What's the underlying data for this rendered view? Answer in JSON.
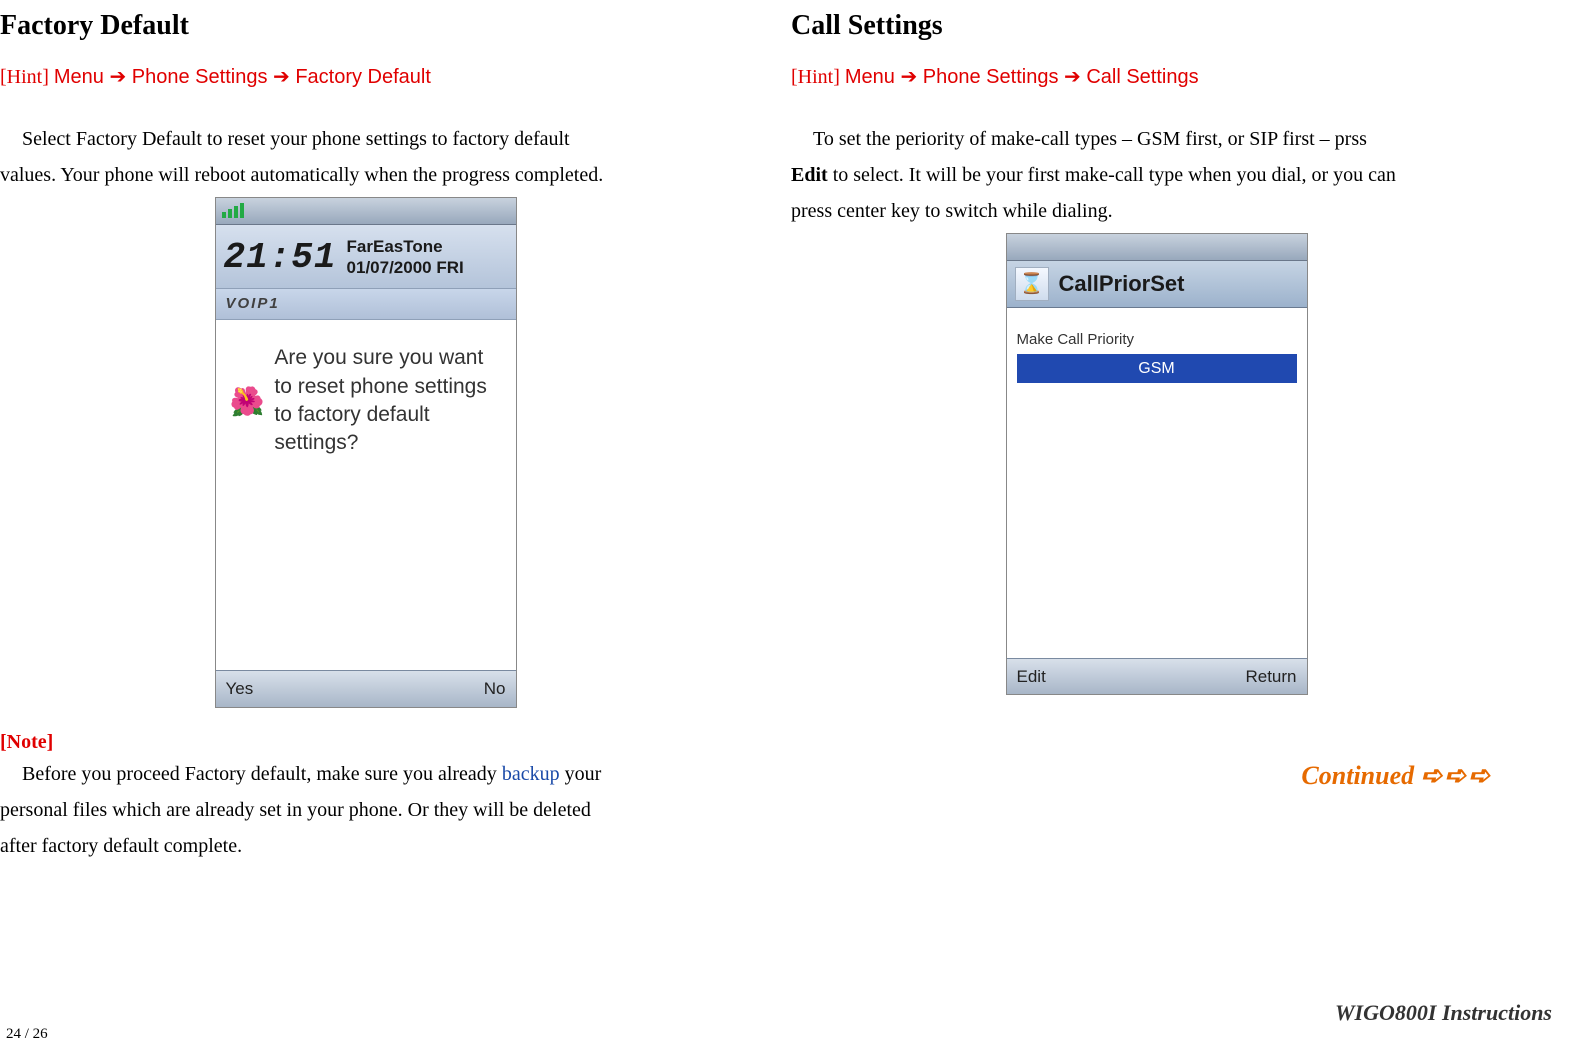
{
  "left": {
    "heading": "Factory Default",
    "hint_prefix": "[Hint] ",
    "hint_path": "Menu ➔ Phone Settings ➔ Factory Default",
    "para1a": "Select Factory Default to reset your phone settings to factory default",
    "para1b": "values. Your phone will reboot automatically when the progress completed.",
    "phone": {
      "clock": "21:51",
      "carrier": "FarEasTone",
      "date": "01/07/2000 FRI",
      "voip": "VOIP1",
      "prompt": "Are you sure you want to reset phone settings to factory default settings?",
      "soft_left": "Yes",
      "soft_right": "No"
    },
    "note_label": "[Note]",
    "note1a": "Before you proceed Factory default, make sure you already ",
    "note1_link": "backup",
    "note1b": " your",
    "note2": "personal files which are already set in your phone. Or they will be deleted",
    "note3": "after factory default complete."
  },
  "right": {
    "heading": "Call Settings",
    "hint_prefix": "[Hint] ",
    "hint_path": "Menu ➔ Phone Settings ➔ Call Settings",
    "para1a": "To set the periority of make-call types – GSM first, or SIP first – prss",
    "para1b_bold": "Edit",
    "para1b_rest": " to select. It will be your first make-call type when you dial, or you can",
    "para1c": "press center key to switch while dialing.",
    "phone": {
      "title": "CallPriorSet",
      "field_label": "Make Call Priority",
      "field_value": "GSM",
      "soft_left": "Edit",
      "soft_right": "Return"
    },
    "continued_text": "Continued",
    "continued_arrows": "➪➪➪"
  },
  "footer": {
    "page": "24 / 26",
    "doc": "WIGO800I Instructions"
  }
}
